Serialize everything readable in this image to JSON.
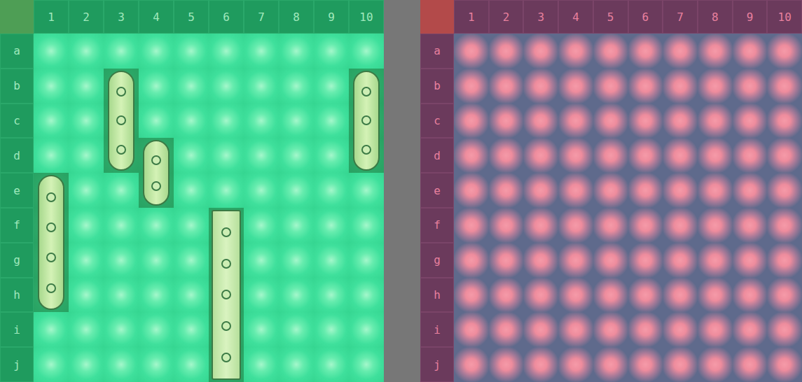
{
  "boards": [
    {
      "kind": "own",
      "columns": [
        "1",
        "2",
        "3",
        "4",
        "5",
        "6",
        "7",
        "8",
        "9",
        "10"
      ],
      "rows": [
        "a",
        "b",
        "c",
        "d",
        "e",
        "f",
        "g",
        "h",
        "i",
        "j"
      ],
      "ships": [
        {
          "start_row": "b",
          "start_column": "3",
          "length": 3,
          "vertical": true
        },
        {
          "start_row": "d",
          "start_column": "4",
          "length": 2,
          "vertical": true
        },
        {
          "start_row": "b",
          "start_column": "10",
          "length": 3,
          "vertical": true
        },
        {
          "start_row": "e",
          "start_column": "1",
          "length": 4,
          "vertical": true
        },
        {
          "start_row": "f",
          "start_column": "6",
          "length": 5,
          "vertical": true
        }
      ]
    },
    {
      "kind": "enemy",
      "columns": [
        "1",
        "2",
        "3",
        "4",
        "5",
        "6",
        "7",
        "8",
        "9",
        "10"
      ],
      "rows": [
        "a",
        "b",
        "c",
        "d",
        "e",
        "f",
        "g",
        "h",
        "i",
        "j"
      ],
      "ships": []
    }
  ]
}
